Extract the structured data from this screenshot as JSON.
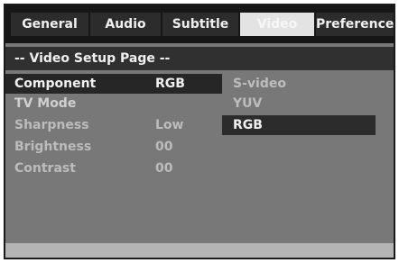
{
  "tabs": [
    {
      "label": "General",
      "active": false
    },
    {
      "label": "Audio",
      "active": false
    },
    {
      "label": "Subtitle",
      "active": false
    },
    {
      "label": "Video",
      "active": true
    },
    {
      "label": "Preference",
      "active": false
    }
  ],
  "page_title": "-- Video Setup Page --",
  "settings": [
    {
      "label": "Component",
      "value": "RGB",
      "selected": true
    },
    {
      "label": "TV Mode",
      "value": ""
    },
    {
      "label": "Sharpness",
      "value": "Low"
    },
    {
      "label": "Brightness",
      "value": "00"
    },
    {
      "label": "Contrast",
      "value": "00"
    }
  ],
  "options": [
    {
      "label": "S-video",
      "selected": false
    },
    {
      "label": "YUV",
      "selected": false
    },
    {
      "label": "RGB",
      "selected": true
    }
  ],
  "colors": {
    "background": "#787878",
    "tabbar": "#161616",
    "selected": "#262626",
    "active_tab": "#e3e3e3"
  }
}
